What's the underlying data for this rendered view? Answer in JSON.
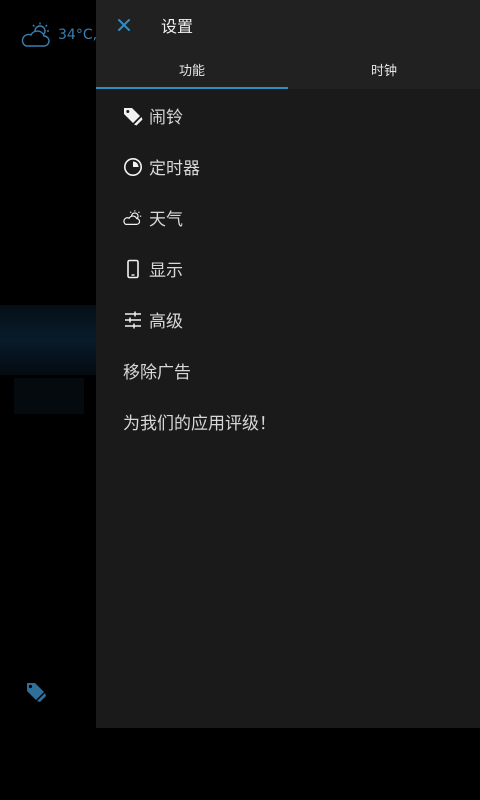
{
  "background": {
    "temperature": "34°C,"
  },
  "drawer": {
    "title": "设置",
    "tabs": [
      {
        "label": "功能",
        "active": true
      },
      {
        "label": "时钟",
        "active": false
      }
    ],
    "items": [
      {
        "label": "闹铃",
        "icon": "alarm-tag-icon"
      },
      {
        "label": "定时器",
        "icon": "timer-icon"
      },
      {
        "label": "天气",
        "icon": "weather-icon"
      },
      {
        "label": "显示",
        "icon": "phone-icon"
      },
      {
        "label": "高级",
        "icon": "sliders-icon"
      },
      {
        "label": "移除广告"
      },
      {
        "label": "为我们的应用评级！"
      }
    ]
  },
  "colors": {
    "accent": "#2f8fc4",
    "drawer_bg": "#1a1a1a",
    "header_bg": "#212121"
  }
}
